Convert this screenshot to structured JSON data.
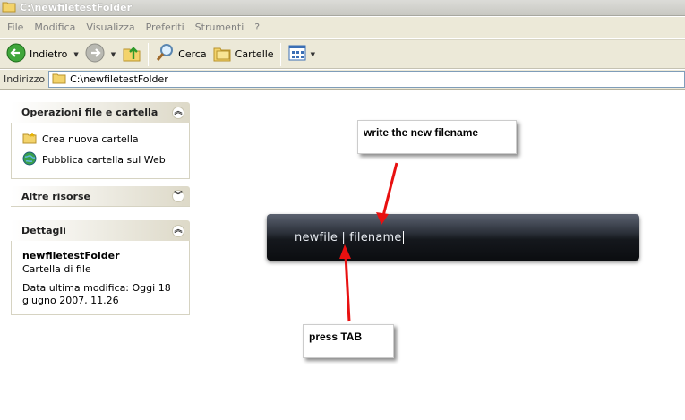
{
  "window": {
    "title": "C:\\newfiletestFolder"
  },
  "menu": [
    "File",
    "Modifica",
    "Visualizza",
    "Preferiti",
    "Strumenti",
    "?"
  ],
  "toolbar": {
    "back_label": "Indietro",
    "search_label": "Cerca",
    "folders_label": "Cartelle"
  },
  "address": {
    "label": "Indirizzo",
    "value": "C:\\newfiletestFolder"
  },
  "panels": {
    "tasks": {
      "title": "Operazioni file e cartella",
      "items": [
        "Crea nuova cartella",
        "Pubblica cartella sul Web"
      ]
    },
    "other": {
      "title": "Altre risorse"
    },
    "details": {
      "title": "Dettagli",
      "name": "newfiletestFolder",
      "type": "Cartella di file",
      "modified": "Data ultima modifica: Oggi 18 giugno 2007, 11.26"
    }
  },
  "launcher": {
    "text": "newfile  |  filename"
  },
  "callouts": {
    "top": "write the new filename",
    "bottom": "press TAB"
  },
  "colors": {
    "arrow": "#e81010",
    "launcher_bg": "#15181d"
  }
}
